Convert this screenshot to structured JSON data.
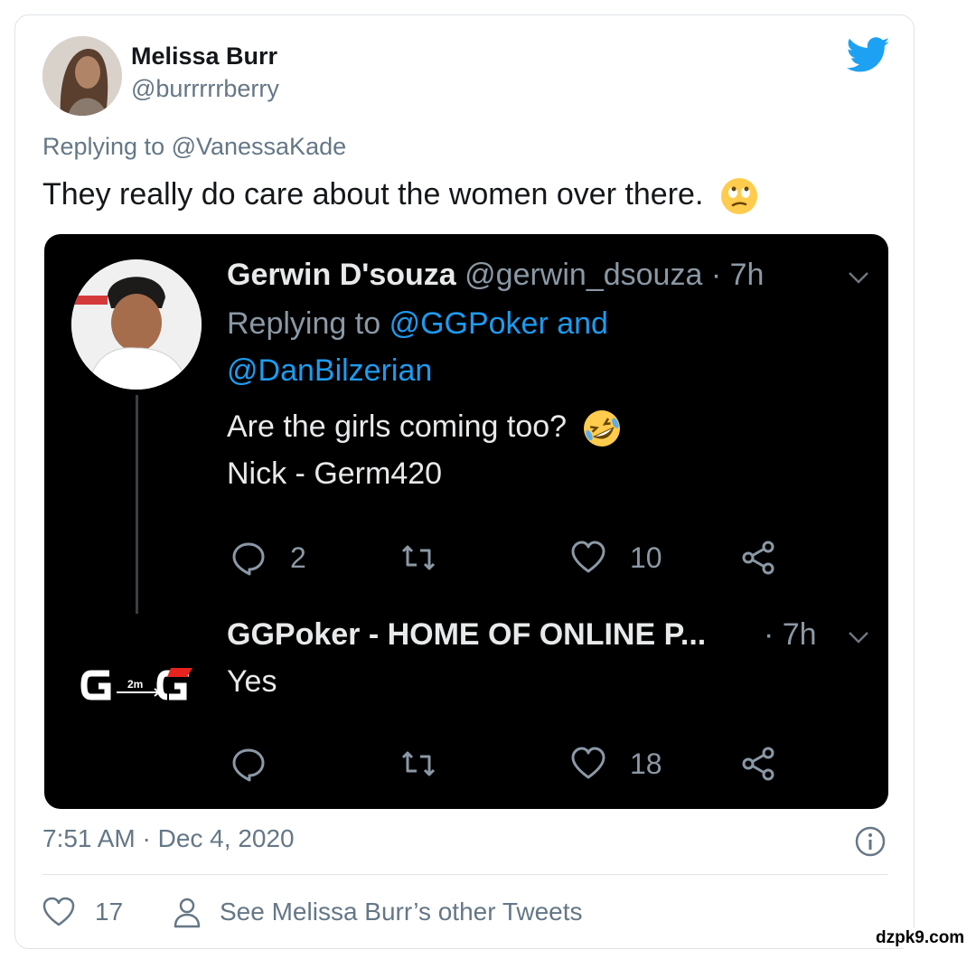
{
  "tweet": {
    "author_name": "Melissa Burr",
    "author_handle": "@burrrrrberry",
    "replying_to": "Replying to @VanessaKade",
    "text": "They really do care about the women over there.",
    "emoji": "eye-roll-emoji",
    "timestamp": "7:51 AM · Dec 4, 2020",
    "likes": "17",
    "other_tweets_link": "See Melissa Burr’s other Tweets"
  },
  "embedded": {
    "reply": {
      "name": "Gerwin D'souza",
      "handle": "@gerwin_dsouza",
      "time": "· 7h",
      "replying_prefix": "Replying to",
      "mention_1": "@GGPoker and",
      "mention_2": "@DanBilzerian",
      "line1": "Are the girls coming too?",
      "line1_emoji": "rofl-emoji",
      "line2": "Nick - Germ420",
      "replies": "2",
      "likes": "10"
    },
    "response": {
      "name": "GGPoker - HOME OF ONLINE P...",
      "time": "· 7h",
      "text": "Yes",
      "likes": "18",
      "logo_text": "2m"
    }
  },
  "colors": {
    "twitter_blue": "#1d9bf0",
    "muted_gray": "#657786",
    "dark_bg": "#000000",
    "gg_red": "#e6231e"
  },
  "watermark": "dzpk9.com"
}
